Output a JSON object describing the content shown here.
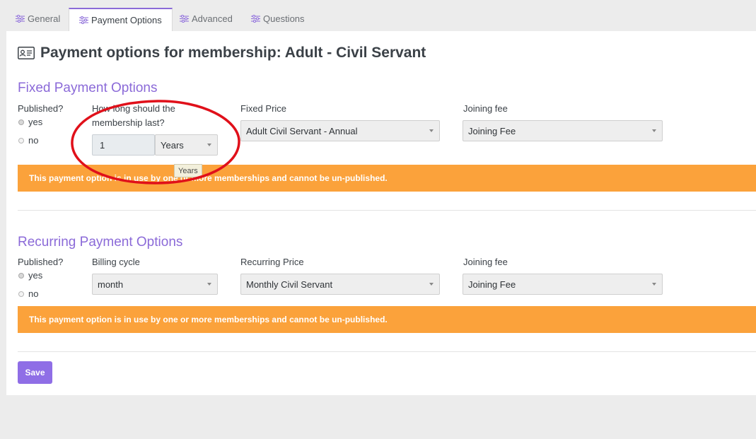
{
  "tabs": [
    {
      "label": "General",
      "icon": "sliders-icon"
    },
    {
      "label": "Payment Options",
      "icon": "sliders-icon",
      "active": true
    },
    {
      "label": "Advanced",
      "icon": "sliders-icon"
    },
    {
      "label": "Questions",
      "icon": "sliders-icon"
    }
  ],
  "page": {
    "title": "Payment options for membership: Adult - Civil Servant",
    "title_icon": "id-card-icon"
  },
  "fixed": {
    "heading": "Fixed Payment Options",
    "published_label": "Published?",
    "yes": "yes",
    "no": "no",
    "selected": "yes",
    "duration_label_line1": "How long should the",
    "duration_label_line2": "membership last?",
    "duration_value": "1",
    "duration_unit": "Years",
    "duration_tooltip": "Years",
    "price_label": "Fixed Price",
    "price_value": "Adult Civil Servant - Annual",
    "joining_label": "Joining fee",
    "joining_value": "Joining Fee",
    "banner": "This payment option is in use by one or more memberships and cannot be un-published."
  },
  "recurring": {
    "heading": "Recurring Payment Options",
    "published_label": "Published?",
    "yes": "yes",
    "no": "no",
    "selected": "yes",
    "billing_label": "Billing cycle",
    "billing_value": "month",
    "price_label": "Recurring Price",
    "price_value": "Monthly Civil Servant",
    "joining_label": "Joining fee",
    "joining_value": "Joining Fee",
    "banner": "This payment option is in use by one or more memberships and cannot be un-published."
  },
  "actions": {
    "save_label": "Save"
  },
  "colors": {
    "accent": "#8b6ad8",
    "banner": "#fba23b",
    "annotation": "#e0101a",
    "background": "#ececec"
  }
}
